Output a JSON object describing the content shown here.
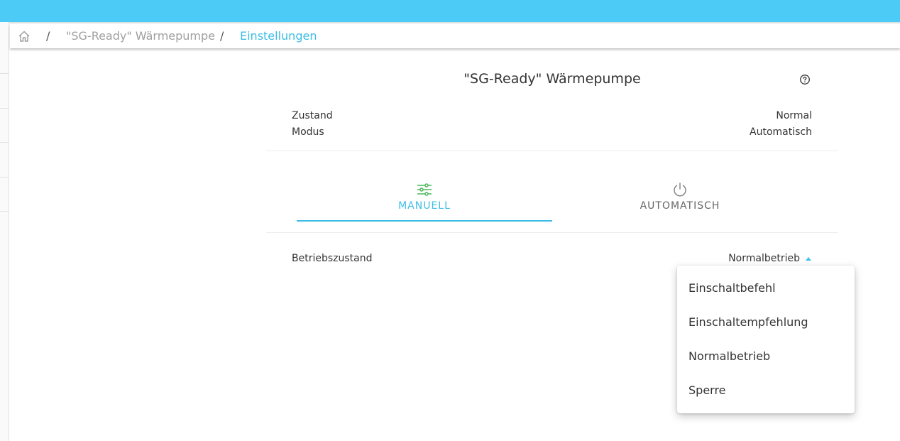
{
  "breadcrumb": {
    "home_icon": "home-icon",
    "separator": "/",
    "device": "\"SG-Ready\" Wärmepumpe",
    "current": "Einstellungen"
  },
  "card": {
    "title": "\"SG-Ready\" Wärmepumpe",
    "help_icon": "help-circle-icon",
    "status": [
      {
        "label": "Zustand",
        "value": "Normal"
      },
      {
        "label": "Modus",
        "value": "Automatisch"
      }
    ]
  },
  "tabs": [
    {
      "label": "MANUELL",
      "icon": "sliders-icon",
      "active": true
    },
    {
      "label": "AUTOMATISCH",
      "icon": "power-icon",
      "active": false
    }
  ],
  "setting": {
    "label": "Betriebszustand",
    "selected": "Normalbetrieb",
    "options": [
      "Einschaltbefehl",
      "Einschaltempfehlung",
      "Normalbetrieb",
      "Sperre"
    ]
  },
  "colors": {
    "topbar": "#4ccbf6",
    "accent": "#3cbde8",
    "sliders_icon": "#4cb85c"
  }
}
